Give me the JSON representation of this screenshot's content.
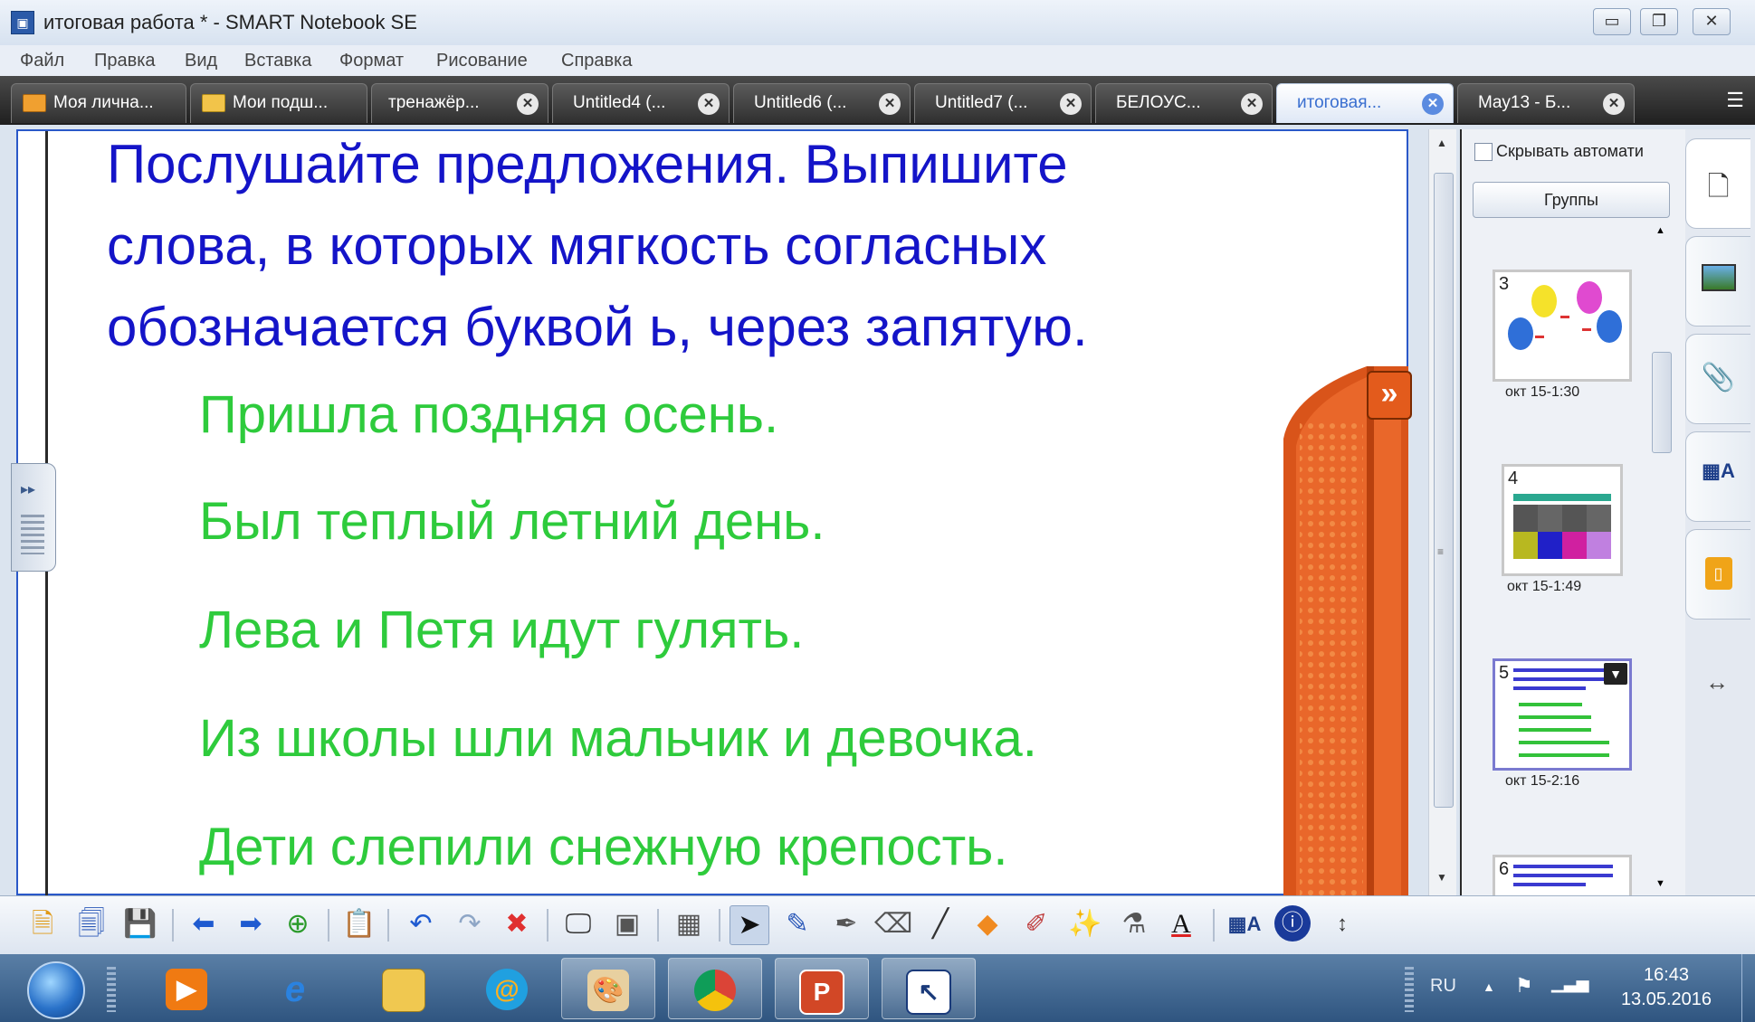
{
  "window": {
    "title": "итоговая работа * - SMART Notebook SE",
    "controls": {
      "minimize": "▭",
      "restore": "❐",
      "close": "✕"
    }
  },
  "menu": [
    "Файл",
    "Правка",
    "Вид",
    "Вставка",
    "Формат",
    "Рисование",
    "Справка"
  ],
  "tabs": [
    {
      "label": "Моя лична...",
      "icon": "home-icon",
      "closable": false,
      "active": false
    },
    {
      "label": "Мои подш...",
      "icon": "folder-icon",
      "closable": false,
      "active": false
    },
    {
      "label": "тренажёр...",
      "icon": "",
      "closable": true,
      "active": false
    },
    {
      "label": "Untitled4 (...",
      "icon": "",
      "closable": true,
      "active": false
    },
    {
      "label": "Untitled6 (...",
      "icon": "",
      "closable": true,
      "active": false
    },
    {
      "label": "Untitled7 (...",
      "icon": "",
      "closable": true,
      "active": false
    },
    {
      "label": "БЕЛОУС...",
      "icon": "",
      "closable": true,
      "active": false
    },
    {
      "label": "итоговая...",
      "icon": "",
      "closable": true,
      "active": true
    },
    {
      "label": "May13 - Б...",
      "icon": "",
      "closable": true,
      "active": false
    }
  ],
  "page": {
    "prompt": "Послушайте предложения. Выпишите слова, в которых мягкость согласных обозначается буквой ь, через запятую.",
    "sentences": [
      "Пришла поздняя осень.",
      "Был теплый летний день.",
      "Лева и Петя идут гулять.",
      "Из школы шли мальчик и девочка.",
      "Дети слепили снежную крепость."
    ],
    "prompt_color": "#1414c8",
    "sentence_color": "#2ecb3c"
  },
  "sidebar": {
    "autohide_label": "Скрывать автомати",
    "groups_label": "Группы",
    "pages": [
      {
        "number": "3",
        "date": "окт 15-1:30"
      },
      {
        "number": "4",
        "date": "окт 15-1:49"
      },
      {
        "number": "5",
        "date": "окт 15-2:16"
      },
      {
        "number": "6",
        "date": ""
      }
    ]
  },
  "taskbar": {
    "language": "RU",
    "time": "16:43",
    "date": "13.05.2016"
  }
}
